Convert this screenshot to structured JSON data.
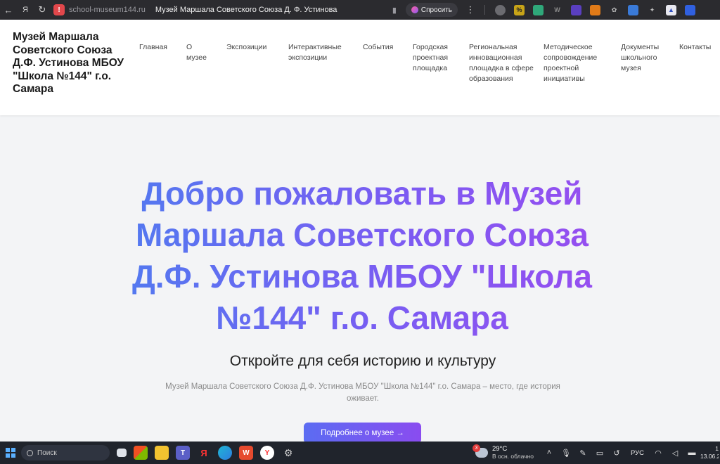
{
  "browser": {
    "back_icon": "←",
    "yandex_icon": "Я",
    "reload_icon": "↻",
    "warning_icon": "!",
    "url_host": "school-museum144.ru",
    "tab_title": "Музей Маршала Советского Союза Д. Ф. Устинова",
    "bookmark_icon": "▮",
    "ask_label": "Спросить",
    "menu_icon": "⋮"
  },
  "site": {
    "title": "Музей Маршала Советского Союза Д.Ф. Устинова МБОУ \"Школа №144\" г.о. Самара",
    "nav": [
      "Главная",
      "О музее",
      "Экспозиции",
      "Интерактивные экспозиции",
      "События",
      "Городская проектная площадка",
      "Региональная инновационная площадка в сфере образования",
      "Методическое сопровождение проектной инициативы",
      "Документы школьного музея",
      "Контакты"
    ]
  },
  "hero": {
    "title": "Добро пожаловать в Музей Маршала Советского Союза Д.Ф. Устинова МБОУ \"Школа №144\" г.о. Самара",
    "subtitle": "Откройте для себя историю и культуру",
    "description": "Музей Маршала Советского Союза Д.Ф. Устинова МБОУ \"Школа №144\" г.о. Самара – место, где история оживает.",
    "button": "Подробнее о музее →"
  },
  "taskbar": {
    "search_label": "Поиск",
    "apps": [
      "file-explorer",
      "store",
      "folder",
      "teams",
      "yandex",
      "edge",
      "browser-w",
      "yandex-browser",
      "settings"
    ],
    "weather_badge": "3",
    "weather_temp": "29°C",
    "weather_desc": "В осн. облачно",
    "language": "РУС",
    "time": "1",
    "date": "13.06.2"
  },
  "colors": {
    "accent_start": "#4f7cf0",
    "accent_end": "#9a4cf0",
    "browser_bg": "#2b2b2f",
    "taskbar_bg": "#20242c"
  }
}
